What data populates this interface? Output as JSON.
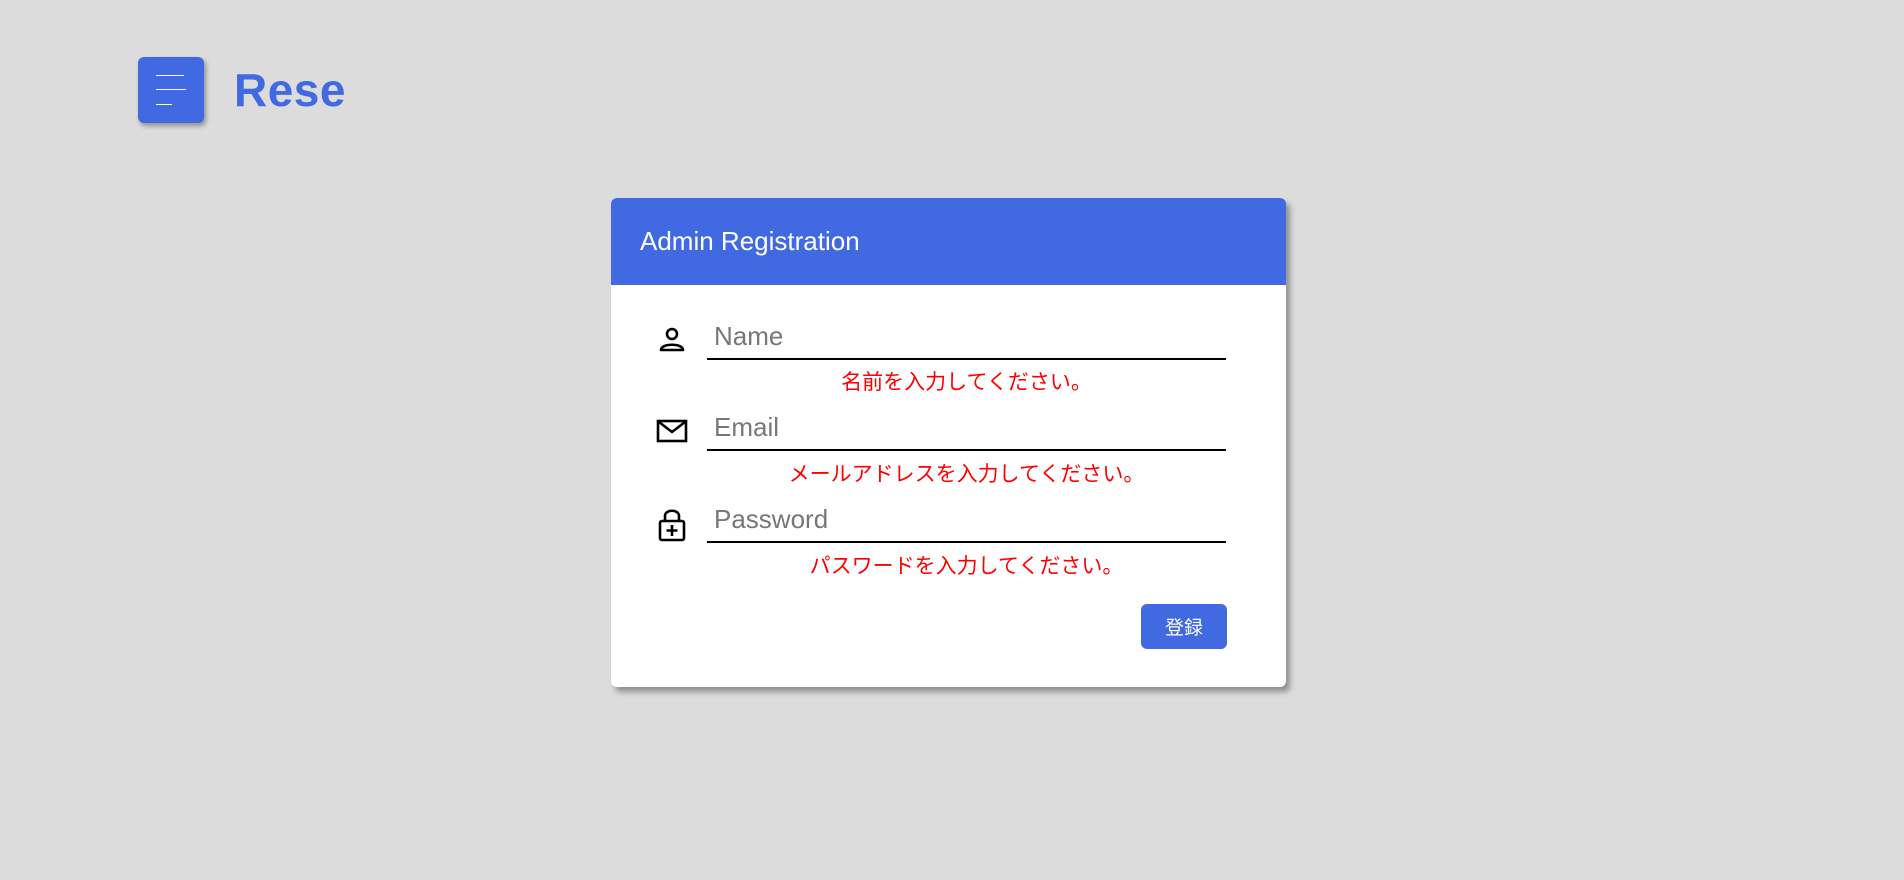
{
  "header": {
    "menu_icon": "hamburger-menu-icon",
    "brand": "Rese"
  },
  "form": {
    "title": "Admin Registration",
    "fields": [
      {
        "icon": "person-icon",
        "placeholder": "Name",
        "value": "",
        "error": "名前を入力してください。"
      },
      {
        "icon": "mail-icon",
        "placeholder": "Email",
        "value": "",
        "error": "メールアドレスを入力してください。"
      },
      {
        "icon": "lock-plus-icon",
        "placeholder": "Password",
        "value": "",
        "error": "パスワードを入力してください。"
      }
    ],
    "submit_label": "登録"
  },
  "colors": {
    "accent": "#4169e1",
    "error": "#ff0000",
    "background": "#dcdcdc"
  }
}
